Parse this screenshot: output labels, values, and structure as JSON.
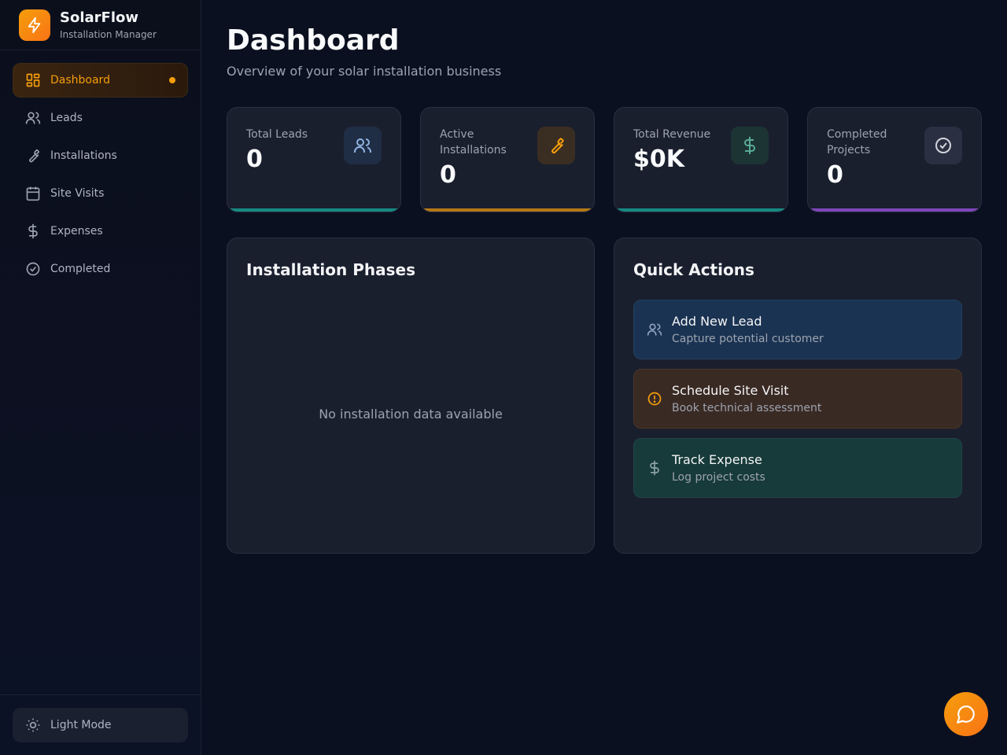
{
  "brand": {
    "title": "SolarFlow",
    "subtitle": "Installation Manager"
  },
  "sidebar": {
    "items": [
      {
        "label": "Dashboard",
        "icon": "dashboard-grid-icon",
        "active": true
      },
      {
        "label": "Leads",
        "icon": "users-icon"
      },
      {
        "label": "Installations",
        "icon": "wrench-icon"
      },
      {
        "label": "Site Visits",
        "icon": "calendar-icon"
      },
      {
        "label": "Expenses",
        "icon": "dollar-icon"
      },
      {
        "label": "Completed",
        "icon": "check-circle-icon"
      }
    ],
    "mode_label": "Light Mode"
  },
  "header": {
    "title": "Dashboard",
    "subtitle": "Overview of your solar installation business"
  },
  "stats": [
    {
      "label": "Total Leads",
      "value": "0",
      "color": "#14b8a6"
    },
    {
      "label": "Active Installations",
      "value": "0",
      "color": "#f59e0b"
    },
    {
      "label": "Total Revenue",
      "value": "$0K",
      "color": "#14b8a6"
    },
    {
      "label": "Completed Projects",
      "value": "0",
      "color": "#a855f7"
    }
  ],
  "phases": {
    "title": "Installation Phases",
    "empty_text": "No installation data available"
  },
  "quick_actions": {
    "title": "Quick Actions",
    "items": [
      {
        "title": "Add New Lead",
        "subtitle": "Capture potential customer"
      },
      {
        "title": "Schedule Site Visit",
        "subtitle": "Book technical assessment"
      },
      {
        "title": "Track Expense",
        "subtitle": "Log project costs"
      }
    ]
  },
  "colors": {
    "accent": "#f59e0b",
    "background": "#0b1020",
    "card": "#1a1f2e"
  }
}
